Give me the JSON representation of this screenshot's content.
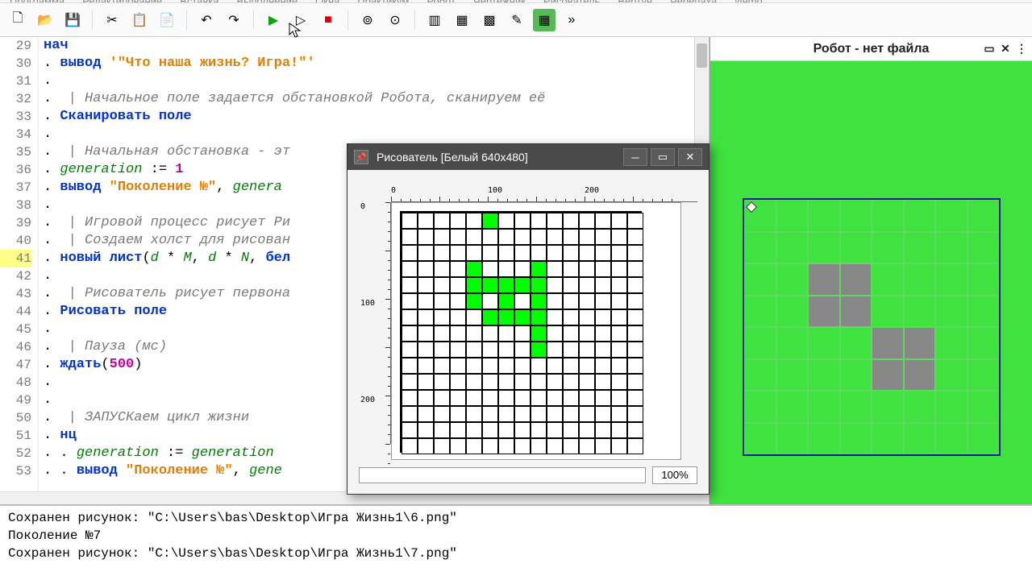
{
  "menubar": [
    "Программа",
    "Редактирование",
    "Вставка",
    "Выполнение",
    "Окна",
    "Практикум",
    "Робот",
    "Чертёжник",
    "Рисователь",
    "Вертун",
    "Черепаха",
    "Инфо"
  ],
  "robot": {
    "title": "Робот - нет файла",
    "gray_cells": [
      18,
      19,
      26,
      27,
      36,
      37,
      44,
      45
    ]
  },
  "painter": {
    "title": "Рисователь [Белый 640x480]",
    "zoom": "100%",
    "ruler_h_labels": [
      "0",
      "100",
      "200"
    ],
    "ruler_v_labels": [
      "0",
      "100",
      "200"
    ],
    "on_cells": [
      5,
      49,
      53,
      64,
      65,
      66,
      67,
      68,
      79,
      81,
      83,
      95,
      96,
      97,
      98,
      113,
      128
    ]
  },
  "lines": [
    {
      "n": 29,
      "html": "<span class='kw'>нач</span>"
    },
    {
      "n": 30,
      "html": ". <span class='kw'>вывод</span> <span class='str'>'\"Что наша жизнь? Игра!\"'</span>"
    },
    {
      "n": 31,
      "html": ". "
    },
    {
      "n": 32,
      "html": ".  <span class='cmt'>| Начальное поле задается обстановкой Робота, сканируем её</span>"
    },
    {
      "n": 33,
      "html": ". <span class='kw'>Сканировать поле</span>"
    },
    {
      "n": 34,
      "html": ". "
    },
    {
      "n": 35,
      "html": ".  <span class='cmt'>| Начальная обстановка - эт</span>"
    },
    {
      "n": 36,
      "html": ". <span class='id'>generation</span> := <span class='num'>1</span>"
    },
    {
      "n": 37,
      "html": ". <span class='kw'>вывод</span> <span class='str'>\"Поколение №\"</span>, <span class='id'>genera</span>"
    },
    {
      "n": 38,
      "html": ". "
    },
    {
      "n": 39,
      "html": ".  <span class='cmt'>| Игровой процесс рисует Ри</span>"
    },
    {
      "n": 40,
      "html": ".  <span class='cmt'>| Создаем холст для рисован</span>"
    },
    {
      "n": 41,
      "hl": true,
      "html": ". <span class='kw'>новый лист</span>(<span class='id'>d</span> * <span class='id'>M</span>, <span class='id'>d</span> * <span class='id'>N</span>, <span class='kw'>бел</span>"
    },
    {
      "n": 42,
      "html": ". "
    },
    {
      "n": 43,
      "html": ".  <span class='cmt'>| Рисователь рисует первона</span>"
    },
    {
      "n": 44,
      "html": ". <span class='kw'>Рисовать поле</span>"
    },
    {
      "n": 45,
      "html": ". "
    },
    {
      "n": 46,
      "html": ".  <span class='cmt'>| Пауза (мс)</span>"
    },
    {
      "n": 47,
      "html": ". <span class='kw'>ждать</span>(<span class='num'>500</span>)"
    },
    {
      "n": 48,
      "html": ". "
    },
    {
      "n": 49,
      "html": ". "
    },
    {
      "n": 50,
      "html": ".  <span class='cmt'>| ЗАПУСКаем цикл жизни</span>"
    },
    {
      "n": 51,
      "html": ". <span class='kw'>нц</span>"
    },
    {
      "n": 52,
      "html": ". . <span class='id'>generation</span> := <span class='id'>generation</span> "
    },
    {
      "n": 53,
      "html": ". . <span class='kw'>вывод</span> <span class='str'>\"Поколение №\"</span>, <span class='id'>gene</span>"
    }
  ],
  "console": [
    "Сохранен рисунок: \"C:\\Users\\bas\\Desktop\\Игра Жизнь1\\6.png\"",
    "Поколение №7",
    "Сохранен рисунок: \"C:\\Users\\bas\\Desktop\\Игра Жизнь1\\7.png\""
  ],
  "icons": {
    "new": "🗋",
    "open": "📂",
    "save": "💾",
    "cut": "✂",
    "copy": "📋",
    "paste": "📄",
    "undo": "↶",
    "redo": "↷",
    "run": "▶",
    "step": "▷",
    "stop": "■",
    "more": "»"
  }
}
